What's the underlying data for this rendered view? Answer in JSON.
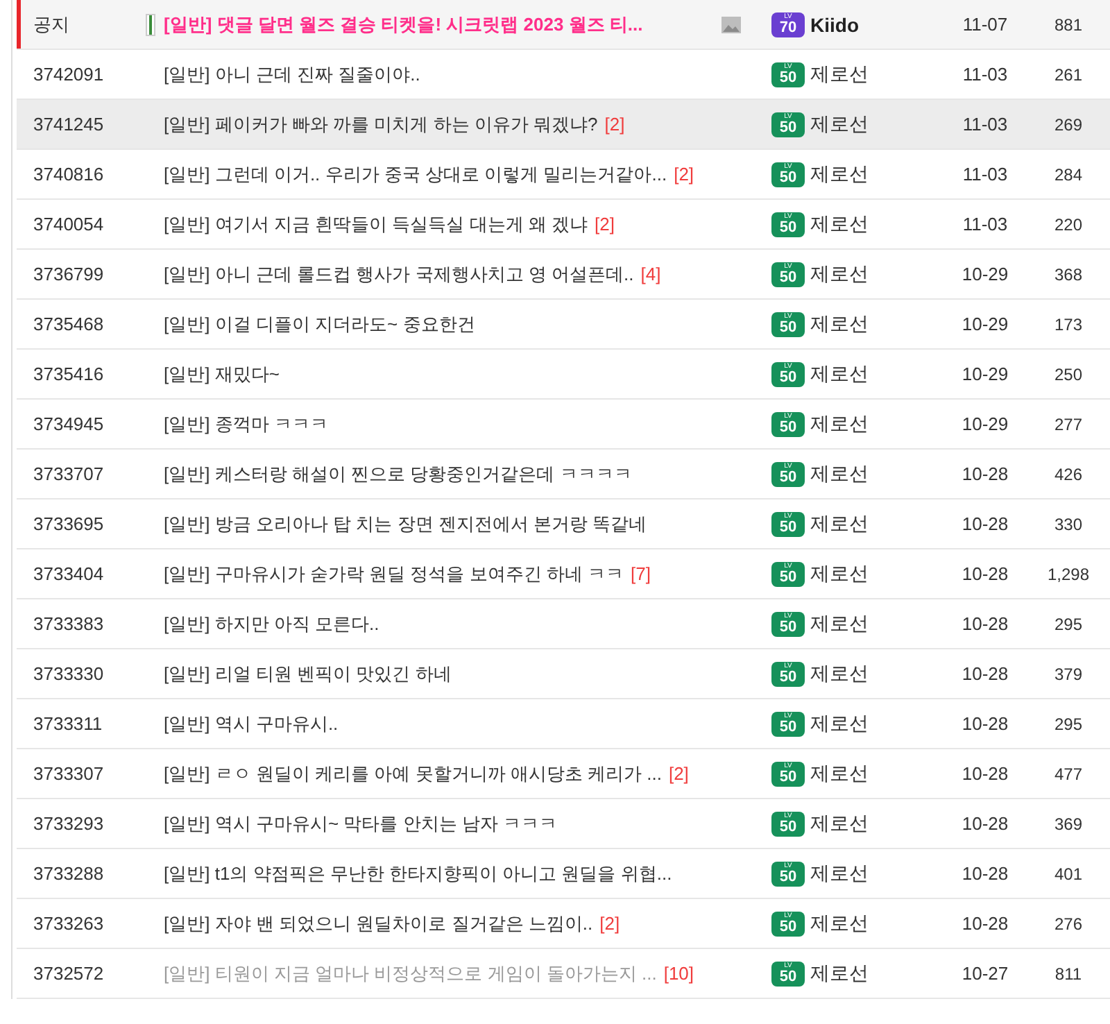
{
  "rows": [
    {
      "kind": "notice",
      "number": "공지",
      "category": "[일반]",
      "title": "댓글 달면 월즈 결승 티켓을! 시크릿랩 2023 월즈 티...",
      "comments": "",
      "has_image": true,
      "level_prefix": "LV",
      "level": "70",
      "color": "#6a3fd1",
      "author": "Kiido",
      "date": "11-07",
      "views": "881",
      "highlighted": false,
      "visited": false
    },
    {
      "kind": "post",
      "number": "3742091",
      "category": "[일반]",
      "title": "아니 근데 진짜 질줄이야..",
      "comments": "",
      "has_image": false,
      "level_prefix": "LV",
      "level": "50",
      "color": "#16915a",
      "author": "제로선",
      "date": "11-03",
      "views": "261",
      "highlighted": false,
      "visited": false
    },
    {
      "kind": "post",
      "number": "3741245",
      "category": "[일반]",
      "title": "페이커가 빠와 까를 미치게 하는 이유가 뭐겠냐?",
      "comments": "[2]",
      "has_image": false,
      "level_prefix": "LV",
      "level": "50",
      "color": "#16915a",
      "author": "제로선",
      "date": "11-03",
      "views": "269",
      "highlighted": true,
      "visited": false
    },
    {
      "kind": "post",
      "number": "3740816",
      "category": "[일반]",
      "title": "그런데 이거.. 우리가 중국 상대로 이렇게 밀리는거같아...",
      "comments": "[2]",
      "has_image": false,
      "level_prefix": "LV",
      "level": "50",
      "color": "#16915a",
      "author": "제로선",
      "date": "11-03",
      "views": "284",
      "highlighted": false,
      "visited": false
    },
    {
      "kind": "post",
      "number": "3740054",
      "category": "[일반]",
      "title": "여기서 지금 흰딱들이 득실득실 대는게 왜 겠냐",
      "comments": "[2]",
      "has_image": false,
      "level_prefix": "LV",
      "level": "50",
      "color": "#16915a",
      "author": "제로선",
      "date": "11-03",
      "views": "220",
      "highlighted": false,
      "visited": false
    },
    {
      "kind": "post",
      "number": "3736799",
      "category": "[일반]",
      "title": "아니 근데 롤드컵 행사가 국제행사치고 영 어설픈데..",
      "comments": "[4]",
      "has_image": false,
      "level_prefix": "LV",
      "level": "50",
      "color": "#16915a",
      "author": "제로선",
      "date": "10-29",
      "views": "368",
      "highlighted": false,
      "visited": false
    },
    {
      "kind": "post",
      "number": "3735468",
      "category": "[일반]",
      "title": "이걸 디플이 지더라도~ 중요한건",
      "comments": "",
      "has_image": false,
      "level_prefix": "LV",
      "level": "50",
      "color": "#16915a",
      "author": "제로선",
      "date": "10-29",
      "views": "173",
      "highlighted": false,
      "visited": false
    },
    {
      "kind": "post",
      "number": "3735416",
      "category": "[일반]",
      "title": "재밌다~",
      "comments": "",
      "has_image": false,
      "level_prefix": "LV",
      "level": "50",
      "color": "#16915a",
      "author": "제로선",
      "date": "10-29",
      "views": "250",
      "highlighted": false,
      "visited": false
    },
    {
      "kind": "post",
      "number": "3734945",
      "category": "[일반]",
      "title": "종꺽마 ㅋㅋㅋ",
      "comments": "",
      "has_image": false,
      "level_prefix": "LV",
      "level": "50",
      "color": "#16915a",
      "author": "제로선",
      "date": "10-29",
      "views": "277",
      "highlighted": false,
      "visited": false
    },
    {
      "kind": "post",
      "number": "3733707",
      "category": "[일반]",
      "title": "케스터랑 해설이 찐으로 당황중인거같은데 ㅋㅋㅋㅋ",
      "comments": "",
      "has_image": false,
      "level_prefix": "LV",
      "level": "50",
      "color": "#16915a",
      "author": "제로선",
      "date": "10-28",
      "views": "426",
      "highlighted": false,
      "visited": false
    },
    {
      "kind": "post",
      "number": "3733695",
      "category": "[일반]",
      "title": "방금 오리아나 탑 치는 장면 젠지전에서 본거랑 똑같네",
      "comments": "",
      "has_image": false,
      "level_prefix": "LV",
      "level": "50",
      "color": "#16915a",
      "author": "제로선",
      "date": "10-28",
      "views": "330",
      "highlighted": false,
      "visited": false
    },
    {
      "kind": "post",
      "number": "3733404",
      "category": "[일반]",
      "title": "구마유시가 숟가락 원딜 정석을 보여주긴 하네 ㅋㅋ",
      "comments": "[7]",
      "has_image": false,
      "level_prefix": "LV",
      "level": "50",
      "color": "#16915a",
      "author": "제로선",
      "date": "10-28",
      "views": "1,298",
      "highlighted": false,
      "visited": false
    },
    {
      "kind": "post",
      "number": "3733383",
      "category": "[일반]",
      "title": "하지만 아직 모른다..",
      "comments": "",
      "has_image": false,
      "level_prefix": "LV",
      "level": "50",
      "color": "#16915a",
      "author": "제로선",
      "date": "10-28",
      "views": "295",
      "highlighted": false,
      "visited": false
    },
    {
      "kind": "post",
      "number": "3733330",
      "category": "[일반]",
      "title": "리얼 티원 벤픽이 맛있긴 하네",
      "comments": "",
      "has_image": false,
      "level_prefix": "LV",
      "level": "50",
      "color": "#16915a",
      "author": "제로선",
      "date": "10-28",
      "views": "379",
      "highlighted": false,
      "visited": false
    },
    {
      "kind": "post",
      "number": "3733311",
      "category": "[일반]",
      "title": "역시 구마유시..",
      "comments": "",
      "has_image": false,
      "level_prefix": "LV",
      "level": "50",
      "color": "#16915a",
      "author": "제로선",
      "date": "10-28",
      "views": "295",
      "highlighted": false,
      "visited": false
    },
    {
      "kind": "post",
      "number": "3733307",
      "category": "[일반]",
      "title": "ㄹㅇ 원딜이 케리를 아예 못할거니까 애시당초 케리가 ...",
      "comments": "[2]",
      "has_image": false,
      "level_prefix": "LV",
      "level": "50",
      "color": "#16915a",
      "author": "제로선",
      "date": "10-28",
      "views": "477",
      "highlighted": false,
      "visited": false
    },
    {
      "kind": "post",
      "number": "3733293",
      "category": "[일반]",
      "title": "역시 구마유시~ 막타를 안치는 남자 ㅋㅋㅋ",
      "comments": "",
      "has_image": false,
      "level_prefix": "LV",
      "level": "50",
      "color": "#16915a",
      "author": "제로선",
      "date": "10-28",
      "views": "369",
      "highlighted": false,
      "visited": false
    },
    {
      "kind": "post",
      "number": "3733288",
      "category": "[일반]",
      "title": "t1의 약점픽은 무난한 한타지향픽이 아니고 원딜을 위협...",
      "comments": "",
      "has_image": false,
      "level_prefix": "LV",
      "level": "50",
      "color": "#16915a",
      "author": "제로선",
      "date": "10-28",
      "views": "401",
      "highlighted": false,
      "visited": false
    },
    {
      "kind": "post",
      "number": "3733263",
      "category": "[일반]",
      "title": "자야 밴 되었으니 원딜차이로 질거같은 느낌이..",
      "comments": "[2]",
      "has_image": false,
      "level_prefix": "LV",
      "level": "50",
      "color": "#16915a",
      "author": "제로선",
      "date": "10-28",
      "views": "276",
      "highlighted": false,
      "visited": false
    },
    {
      "kind": "post",
      "number": "3732572",
      "category": "[일반]",
      "title": "티원이 지금 얼마나 비정상적으로 게임이 돌아가는지 ...",
      "comments": "[10]",
      "has_image": false,
      "level_prefix": "LV",
      "level": "50",
      "color": "#16915a",
      "author": "제로선",
      "date": "10-27",
      "views": "811",
      "highlighted": false,
      "visited": true
    }
  ]
}
